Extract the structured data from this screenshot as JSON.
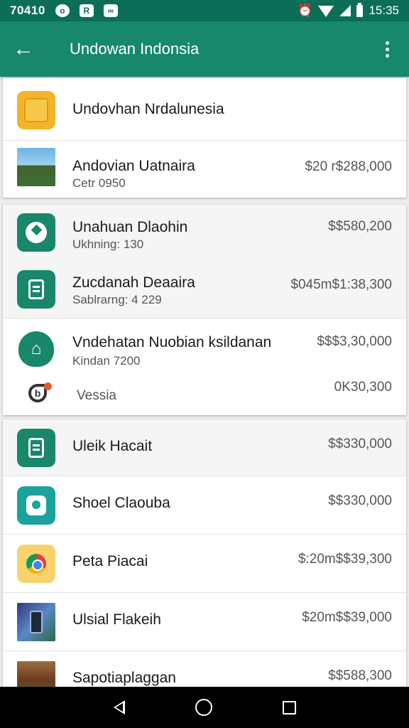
{
  "status_bar": {
    "time": "70410",
    "clock": "15:35"
  },
  "app_bar": {
    "title": "Undowan Indonsia",
    "back_label": "←"
  },
  "list": [
    {
      "title": "Undovhan Nrdalunesia",
      "subtitle": "",
      "price": "",
      "icon": "yellow-folder-icon"
    },
    {
      "title": "Andovian Uatnaira",
      "subtitle": "Cetr 0950",
      "price": "$20 r$288,000",
      "icon": "house-photo-icon"
    },
    {
      "title": "Unahuan Dlaohin",
      "subtitle": "Ukhning: 130",
      "price": "$$580,200",
      "icon": "clock-icon"
    },
    {
      "title": "Zucdanah Deaaira",
      "subtitle": "Sablrarng: 4 229",
      "price": "$045m$1:38,300",
      "icon": "document-icon"
    },
    {
      "title": "Vndehatan Nuobian ksildanan",
      "subtitle": "Kindan 7200",
      "price": "$$$3,30,000",
      "icon": "recycle-icon"
    },
    {
      "title": "Vessia",
      "subtitle": "",
      "price": "0K30,300",
      "icon": "b-app-icon"
    },
    {
      "title": "Uleik Hacait",
      "subtitle": "",
      "price": "$$330,000",
      "icon": "document-icon"
    },
    {
      "title": "Shoel Claouba",
      "subtitle": "",
      "price": "$$330,000",
      "icon": "pin-icon"
    },
    {
      "title": "Peta Piacai",
      "subtitle": "",
      "price": "$:20m$$39,300",
      "icon": "chrome-icon"
    },
    {
      "title": "Ulsial Flakeih",
      "subtitle": "",
      "price": "$20m$$39,000",
      "icon": "phone-icon"
    },
    {
      "title": "Sapotiaplaggan",
      "subtitle": "",
      "price": "$$588,300",
      "icon": "building-photo-icon"
    }
  ]
}
